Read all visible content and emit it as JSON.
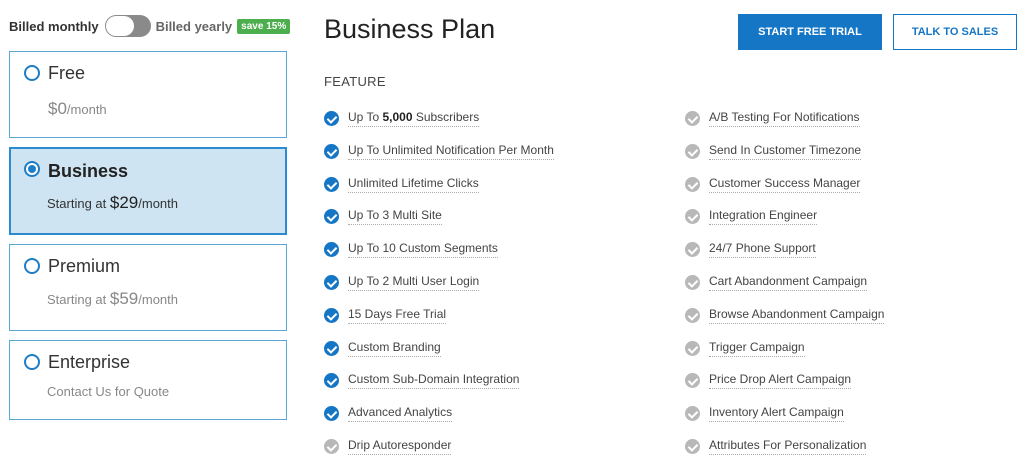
{
  "billing": {
    "monthly_label": "Billed monthly",
    "yearly_label": "Billed yearly",
    "save_badge": "save 15%",
    "toggle_state": "monthly"
  },
  "plans": [
    {
      "name": "Free",
      "prefix": "",
      "amount": "$0",
      "suffix": "/month",
      "selected": false
    },
    {
      "name": "Business",
      "prefix": "Starting at ",
      "amount": "$29",
      "suffix": "/month",
      "selected": true
    },
    {
      "name": "Premium",
      "prefix": "Starting at ",
      "amount": "$59",
      "suffix": "/month",
      "selected": false
    },
    {
      "name": "Enterprise",
      "prefix": "Contact Us for Quote",
      "amount": "",
      "suffix": "",
      "selected": false
    }
  ],
  "main": {
    "title": "Business Plan",
    "start_trial_label": "START FREE TRIAL",
    "talk_sales_label": "TALK TO SALES",
    "feature_heading": "FEATURE"
  },
  "features_col1": [
    {
      "pre": "Up To ",
      "bold": "5,000",
      "post": " Subscribers",
      "included": true
    },
    {
      "pre": "Up To Unlimited Notification Per Month",
      "bold": "",
      "post": "",
      "included": true
    },
    {
      "pre": "Unlimited Lifetime Clicks",
      "bold": "",
      "post": "",
      "included": true
    },
    {
      "pre": "Up To 3 Multi Site",
      "bold": "",
      "post": "",
      "included": true
    },
    {
      "pre": "Up To 10 Custom Segments",
      "bold": "",
      "post": "",
      "included": true
    },
    {
      "pre": "Up To 2 Multi User Login",
      "bold": "",
      "post": "",
      "included": true
    },
    {
      "pre": "15 Days Free Trial",
      "bold": "",
      "post": "",
      "included": true
    },
    {
      "pre": "Custom Branding",
      "bold": "",
      "post": "",
      "included": true
    },
    {
      "pre": "Custom Sub-Domain Integration",
      "bold": "",
      "post": "",
      "included": true
    },
    {
      "pre": "Advanced Analytics",
      "bold": "",
      "post": "",
      "included": true
    },
    {
      "pre": "Drip Autoresponder",
      "bold": "",
      "post": "",
      "included": false
    }
  ],
  "features_col2": [
    {
      "pre": "A/B Testing For Notifications",
      "bold": "",
      "post": "",
      "included": false
    },
    {
      "pre": "Send In Customer Timezone",
      "bold": "",
      "post": "",
      "included": false
    },
    {
      "pre": "Customer Success Manager",
      "bold": "",
      "post": "",
      "included": false
    },
    {
      "pre": "Integration Engineer",
      "bold": "",
      "post": "",
      "included": false
    },
    {
      "pre": "24/7 Phone Support",
      "bold": "",
      "post": "",
      "included": false
    },
    {
      "pre": "Cart Abandonment Campaign",
      "bold": "",
      "post": "",
      "included": false
    },
    {
      "pre": "Browse Abandonment Campaign",
      "bold": "",
      "post": "",
      "included": false
    },
    {
      "pre": "Trigger Campaign",
      "bold": "",
      "post": "",
      "included": false
    },
    {
      "pre": "Price Drop Alert Campaign",
      "bold": "",
      "post": "",
      "included": false
    },
    {
      "pre": "Inventory Alert Campaign",
      "bold": "",
      "post": "",
      "included": false
    },
    {
      "pre": "Attributes For Personalization",
      "bold": "",
      "post": "",
      "included": false
    }
  ],
  "colors": {
    "accent": "#1576c5",
    "selected_bg": "#cfe4f3",
    "included_icon": "#1576c5",
    "excluded_icon": "#b8b8b8",
    "save_badge_bg": "#4cae4c"
  },
  "icons": {
    "included": "check-circle-icon",
    "excluded": "check-circle-icon"
  }
}
